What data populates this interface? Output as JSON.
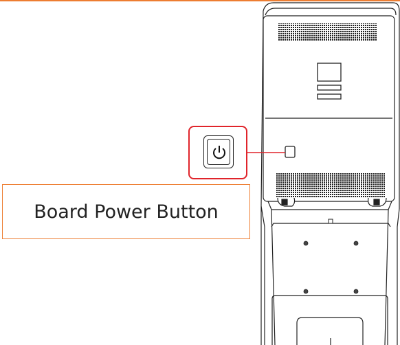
{
  "callout": {
    "label": "Board Power Button",
    "label_border_color": "#ed7d31",
    "highlight_color": "#e0242b",
    "icon": "power-icon"
  },
  "accent_color": "#ed7d31"
}
